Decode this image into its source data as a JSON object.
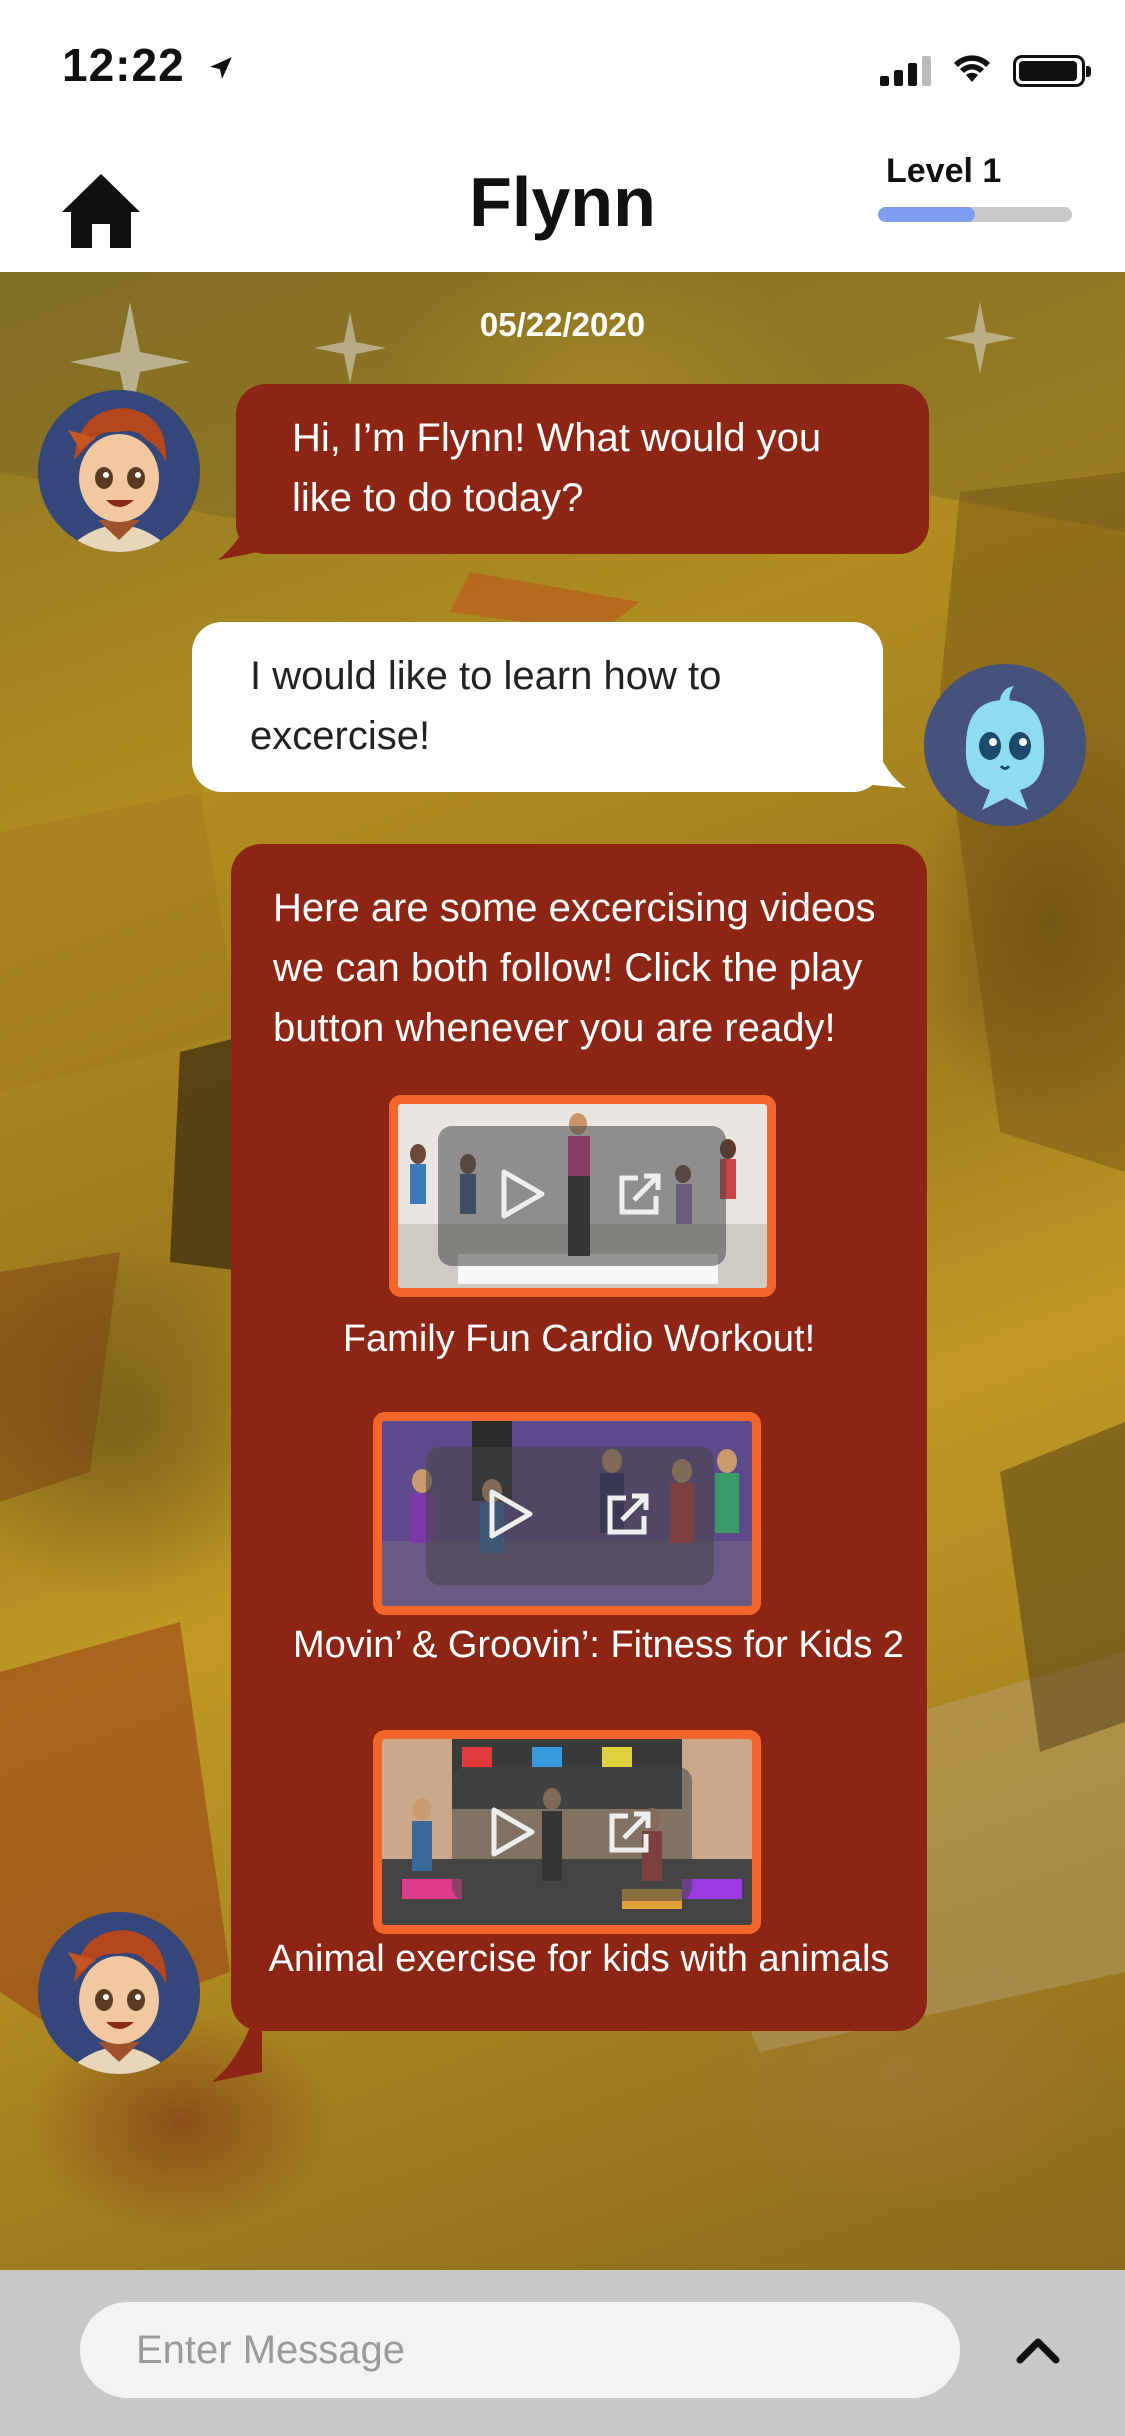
{
  "status_bar": {
    "time": "12:22"
  },
  "header": {
    "title": "Flynn",
    "level_label": "Level 1",
    "level_progress": 0.5
  },
  "chat": {
    "date": "05/22/2020",
    "messages": [
      {
        "sender": "bot",
        "text": "Hi, I’m Flynn! What would you like to do today?"
      },
      {
        "sender": "user",
        "text": "I would like to learn how to excercise!"
      },
      {
        "sender": "bot",
        "text": "Here are some excercising videos we can both follow! Click the play button whenever you are ready!"
      }
    ],
    "videos": [
      {
        "title": "Family Fun Cardio Workout!"
      },
      {
        "title": "Movin’ & Groovin’: Fitness for Kids 2"
      },
      {
        "title": "Animal exercise for kids with animals"
      }
    ]
  },
  "footer": {
    "input_placeholder": "Enter Message",
    "input_value": ""
  },
  "colors": {
    "bot_bubble": "#8c2514",
    "video_border": "#f2662b",
    "level_fill": "#7f9df0"
  }
}
